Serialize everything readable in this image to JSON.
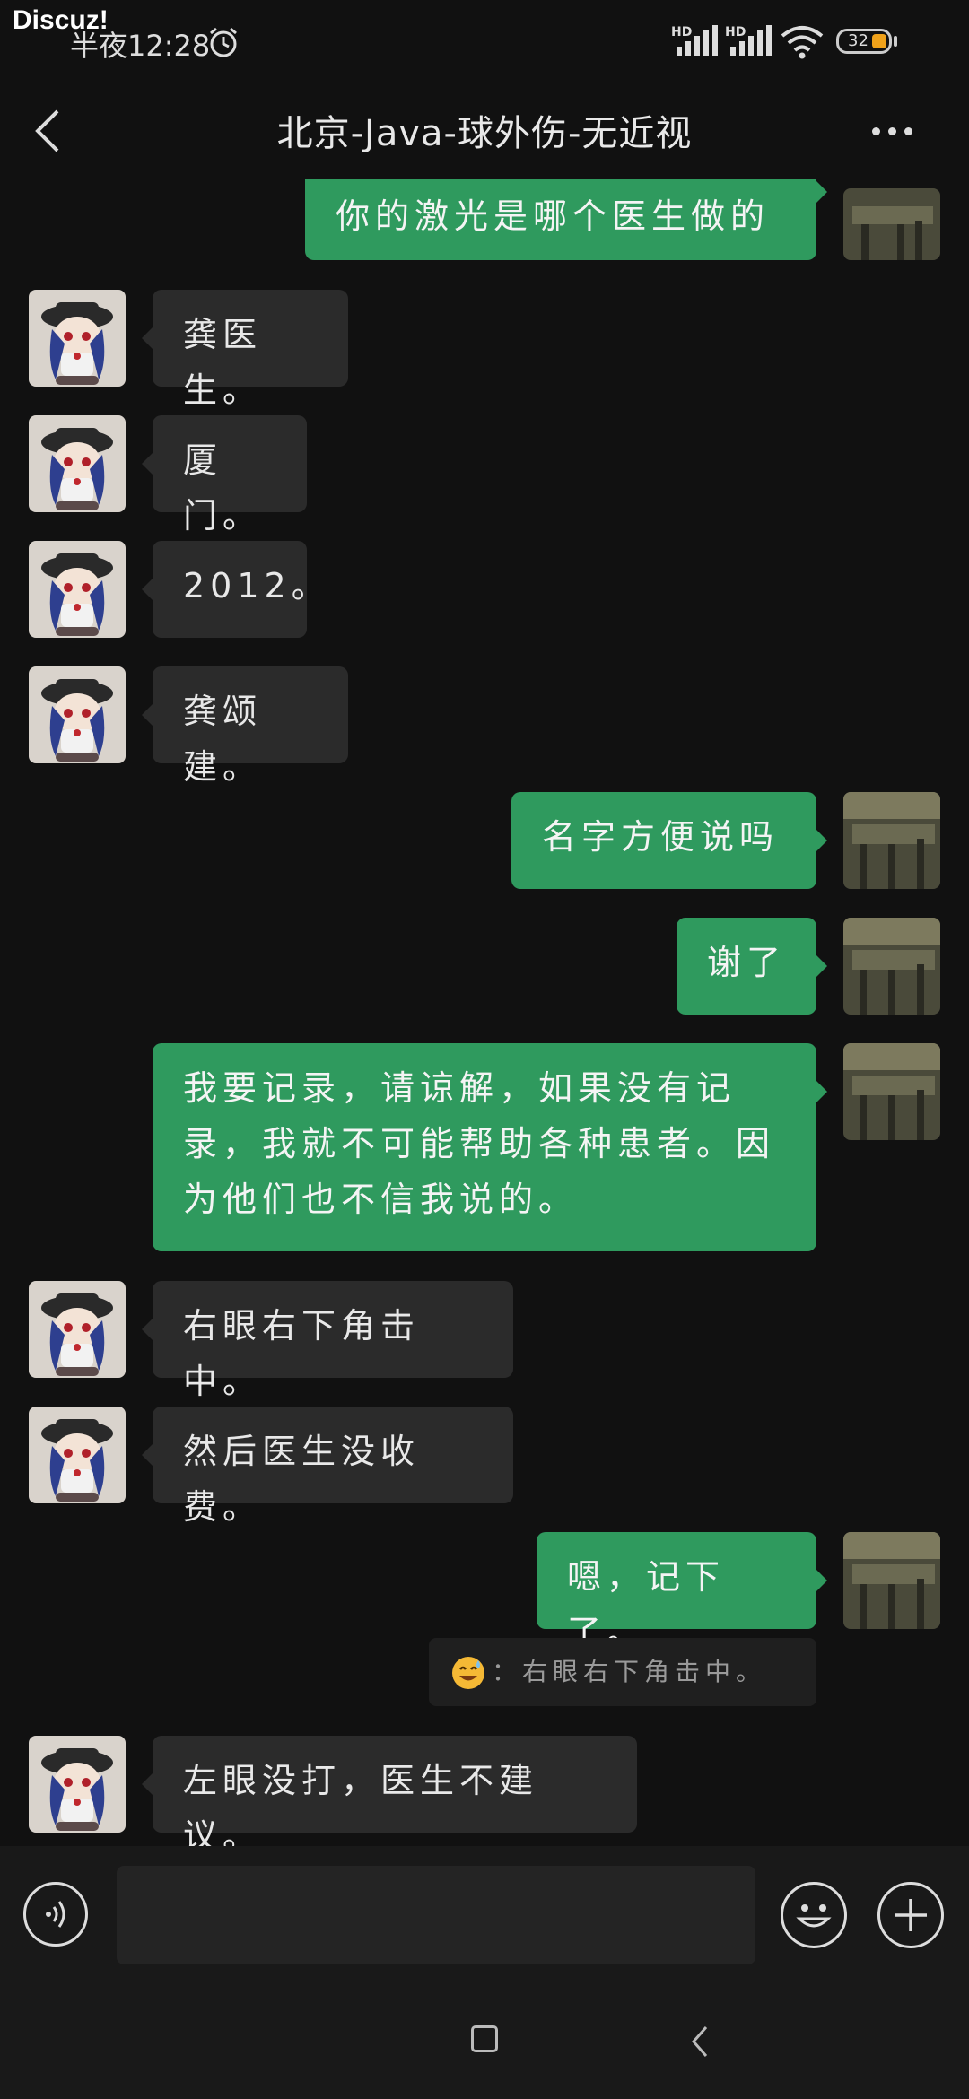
{
  "status": {
    "watermark": "Discuz!",
    "time": "半夜12:28",
    "signal_label_1": "HD",
    "signal_label_2": "HD",
    "battery": "32"
  },
  "header": {
    "title": "北京-Java-球外伤-无近视"
  },
  "messages": [
    {
      "side": "out",
      "lines": [
        "你的激光是哪个医生做的"
      ]
    },
    {
      "side": "in",
      "lines": [
        "龚医生。"
      ]
    },
    {
      "side": "in",
      "lines": [
        "厦门。"
      ]
    },
    {
      "side": "in",
      "lines": [
        "2012。"
      ]
    },
    {
      "side": "in",
      "lines": [
        "龚颂建。"
      ]
    },
    {
      "side": "out",
      "lines": [
        "名字方便说吗"
      ]
    },
    {
      "side": "out",
      "lines": [
        "谢了"
      ]
    },
    {
      "side": "out",
      "lines": [
        "我要记录，请谅解，如果没有记",
        "录，我就不可能帮助各种患者。因",
        "为他们也不信我说的。"
      ]
    },
    {
      "side": "in",
      "lines": [
        "右眼右下角击中。"
      ]
    },
    {
      "side": "in",
      "lines": [
        "然后医生没收费。"
      ]
    },
    {
      "side": "out",
      "lines": [
        "嗯，记下了。"
      ]
    },
    {
      "side": "in",
      "lines": [
        "左眼没打，医生不建议。"
      ]
    }
  ],
  "quote": {
    "text": "：右眼右下角击中。",
    "emoji": "sweat-smile-emoji"
  },
  "input": {
    "value": ""
  },
  "icons": {
    "back": "chevron-left-icon",
    "more": "more-dots-icon",
    "voice": "voice-icon",
    "emoji": "emoji-icon",
    "plus": "plus-icon"
  },
  "colors": {
    "outgoing_bubble": "#2f9a5e",
    "incoming_bubble": "#2b2b2b",
    "background": "#111111"
  }
}
